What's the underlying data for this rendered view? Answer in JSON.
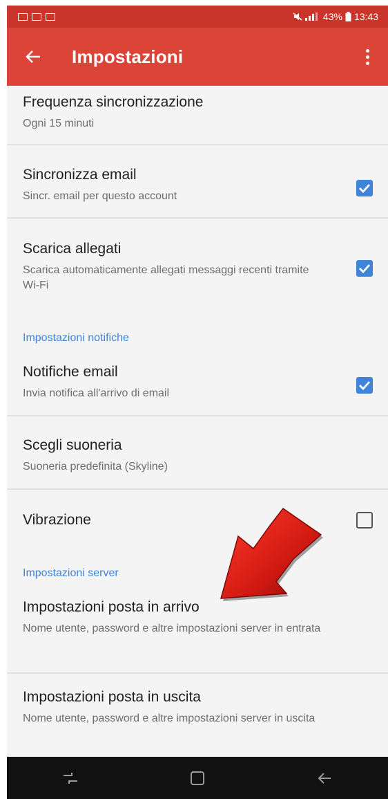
{
  "status_bar": {
    "icons_left": [
      "gallery-icon",
      "mail-icon",
      "mail-icon"
    ],
    "battery": "43%",
    "time": "13:43"
  },
  "app_bar": {
    "title": "Impostazioni",
    "color": "#db4437"
  },
  "items": [
    {
      "title": "Frequenza sincronizzazione",
      "summary": "Ogni 15 minuti"
    },
    {
      "title": "Sincronizza email",
      "summary": "Sincr. email per questo account",
      "checked": true
    },
    {
      "title": "Scarica allegati",
      "summary": "Scarica automaticamente allegati messaggi recenti tramite Wi-Fi",
      "checked": true
    },
    {
      "title": "Notifiche email",
      "summary": "Invia notifica all'arrivo di email",
      "checked": true
    },
    {
      "title": "Scegli suoneria",
      "summary": "Suoneria predefinita (Skyline)"
    },
    {
      "title": "Vibrazione",
      "checked": false
    },
    {
      "title": "Impostazioni posta in arrivo",
      "summary": "Nome utente, password e altre impostazioni server in entrata"
    },
    {
      "title": "Impostazioni posta in uscita",
      "summary": "Nome utente, password e altre impostazioni server in uscita"
    }
  ],
  "sections": {
    "notifications": "Impostazioni notifiche",
    "server": "Impostazioni server"
  },
  "accent_color": "#3f84d9",
  "annotation": {
    "type": "red-arrow-icon",
    "points_to": "Impostazioni posta in arrivo"
  }
}
